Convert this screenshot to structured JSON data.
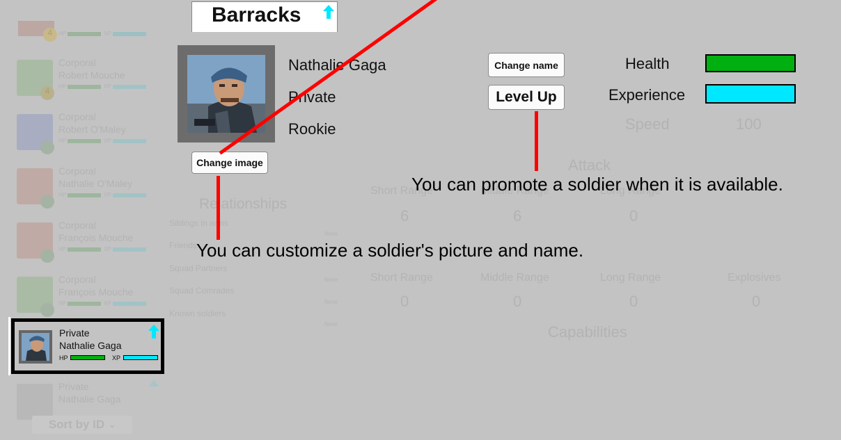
{
  "screen": {
    "title": "Barracks",
    "promotion_available": true
  },
  "soldier": {
    "name": "Nathalie Gaga",
    "rank": "Private",
    "experience_level": "Rookie"
  },
  "buttons": {
    "change_image": "Change image",
    "change_name": "Change name",
    "level_up": "Level Up"
  },
  "stats": {
    "health_label": "Health",
    "experience_label": "Experience",
    "health_fill": 1.0,
    "experience_fill": 1.0,
    "health_color": "#00b010",
    "experience_color": "#00e8ff"
  },
  "callouts": {
    "promote": "You can promote a soldier when it is available.",
    "customize": "You can customize a soldier's picture and name."
  },
  "selected_card": {
    "rank": "Private",
    "name": "Nathalie Gaga",
    "hp_label": "HP",
    "xp_label": "XP"
  },
  "background": {
    "list_items": [
      {
        "rank": "Corporal",
        "name": "Robert Mouche",
        "badge": "4",
        "hp_label": "HP",
        "xp_label": "XP"
      },
      {
        "rank": "Corporal",
        "name": "Robert O'Maley",
        "badge": "",
        "hp_label": "HP",
        "xp_label": "XP"
      },
      {
        "rank": "Corporal",
        "name": "Nathalie O'Maley",
        "badge": "",
        "hp_label": "HP",
        "xp_label": "XP"
      },
      {
        "rank": "Corporal",
        "name": "François Mouche",
        "badge": "",
        "hp_label": "HP",
        "xp_label": "XP"
      },
      {
        "rank": "Corporal",
        "name": "François Mouche",
        "badge": "",
        "hp_label": "HP",
        "xp_label": "XP"
      }
    ],
    "partial_top": {
      "hp_label": "HP",
      "xp_label": "XP",
      "badge": "4"
    },
    "last_item": {
      "rank": "Private",
      "name": "Nathalie Gaga"
    },
    "sort_button": "Sort by ID",
    "relationships": {
      "title": "Relationships",
      "rows": [
        "Siblings in arms",
        "Friends",
        "Squad Partners",
        "Squad Comrades",
        "Known soldiers"
      ],
      "none_labels": [
        "None",
        "None",
        "None",
        "None"
      ]
    },
    "speed": {
      "label": "Speed",
      "value": "100"
    },
    "attack": {
      "title": "Attack",
      "ranges": [
        "Short Range",
        "Middle Range",
        "Long Range"
      ],
      "values": [
        "6",
        "6",
        "0"
      ]
    },
    "defense": {
      "ranges": [
        "Short Range",
        "Middle Range",
        "Long Range",
        "Explosives"
      ],
      "values": [
        "0",
        "0",
        "0",
        "0"
      ]
    },
    "capabilities_title": "Capabilities"
  }
}
